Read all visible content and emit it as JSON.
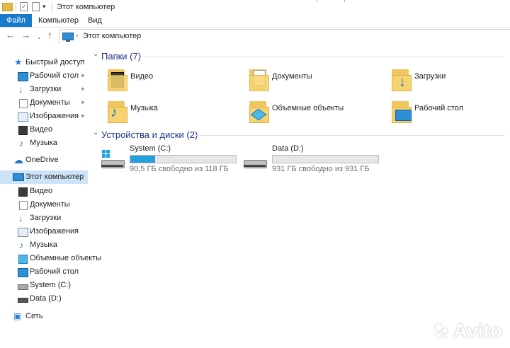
{
  "window": {
    "title": "Этот компьютер",
    "qa_arrow": "▾"
  },
  "ribbon": {
    "tabs": [
      "Файл",
      "Компьютер",
      "Вид"
    ]
  },
  "address": {
    "path": "Этот компьютер",
    "chevron": "›"
  },
  "nav": {
    "back": "←",
    "forward": "→",
    "dropdown": "⌄",
    "up": "↑"
  },
  "sidebar": {
    "items": [
      {
        "label": "Быстрый доступ",
        "icon": "star-icon",
        "pinned": false
      },
      {
        "label": "Рабочий стол",
        "icon": "desktop-icon",
        "pinned": true
      },
      {
        "label": "Загрузки",
        "icon": "downloads-icon",
        "pinned": true
      },
      {
        "label": "Документы",
        "icon": "documents-icon",
        "pinned": true
      },
      {
        "label": "Изображения",
        "icon": "pictures-icon",
        "pinned": true
      },
      {
        "label": "Видео",
        "icon": "video-icon",
        "pinned": false
      },
      {
        "label": "Музыка",
        "icon": "music-icon",
        "pinned": false
      },
      {
        "label": "OneDrive",
        "icon": "cloud-icon",
        "pinned": false
      },
      {
        "label": "Этот компьютер",
        "icon": "computer-icon",
        "selected": true
      },
      {
        "label": "Видео",
        "icon": "video-icon"
      },
      {
        "label": "Документы",
        "icon": "documents-icon"
      },
      {
        "label": "Загрузки",
        "icon": "downloads-icon"
      },
      {
        "label": "Изображения",
        "icon": "pictures-icon"
      },
      {
        "label": "Музыка",
        "icon": "music-icon"
      },
      {
        "label": "Объемные объекты",
        "icon": "3d-objects-icon"
      },
      {
        "label": "Рабочий стол",
        "icon": "desktop-icon"
      },
      {
        "label": "System (C:)",
        "icon": "system-drive-icon"
      },
      {
        "label": "Data (D:)",
        "icon": "data-drive-icon"
      },
      {
        "label": "Сеть",
        "icon": "network-icon"
      }
    ],
    "pin_glyph": "📌"
  },
  "folders_section": {
    "title": "Папки (7)",
    "chevron": "⌄",
    "items": [
      {
        "label": "Видео",
        "icon": "video-folder-icon"
      },
      {
        "label": "Документы",
        "icon": "documents-folder-icon"
      },
      {
        "label": "Загрузки",
        "icon": "downloads-folder-icon"
      },
      {
        "label": "Музыка",
        "icon": "music-folder-icon"
      },
      {
        "label": "Объемные объекты",
        "icon": "3d-objects-folder-icon"
      },
      {
        "label": "Рабочий стол",
        "icon": "desktop-folder-icon"
      }
    ]
  },
  "drives_section": {
    "title": "Устройства и диски (2)",
    "chevron": "⌄",
    "drives": [
      {
        "name": "System (C:)",
        "free": "90,5 ГБ свободно из 118 ГБ",
        "used_fraction": 0.233,
        "icon": "system-drive-icon"
      },
      {
        "name": "Data (D:)",
        "free": "931 ГБ свободно из 931 ГБ",
        "used_fraction": 0.0,
        "icon": "data-drive-icon"
      }
    ]
  },
  "watermark": {
    "text": "Avito"
  },
  "colors": {
    "accent": "#1979ca",
    "selection": "#cce4f7",
    "section_title": "#1e3287",
    "drive_fill": "#26a0da",
    "folder": "#f7d36f"
  }
}
